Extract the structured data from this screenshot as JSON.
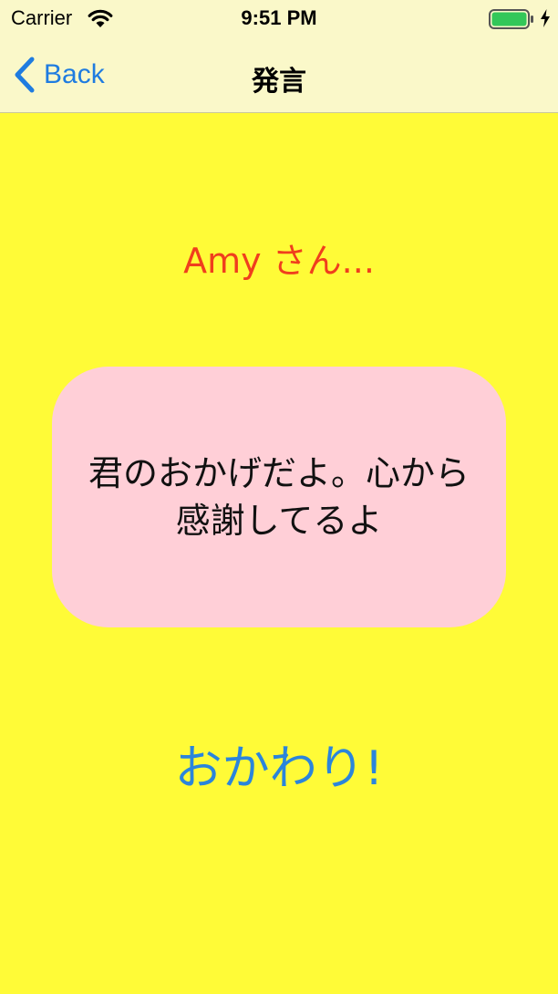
{
  "status_bar": {
    "carrier": "Carrier",
    "time": "9:51 PM"
  },
  "nav": {
    "back_label": "Back",
    "title": "発言"
  },
  "content": {
    "speaker": "Amy さん...",
    "message": "君のおかげだよ。心から\n感謝してるよ",
    "action_label": "おかわり!"
  },
  "colors": {
    "background": "#fffb37",
    "navbar_background": "#faf8c9",
    "speaker_text": "#f03e1d",
    "bubble_background": "#ffcfd7",
    "action_text": "#2b85db",
    "back_text": "#1f7ce0",
    "battery": "#33c759"
  },
  "icons": {
    "wifi": "wifi-icon",
    "battery": "battery-icon",
    "charging": "charging-bolt-icon",
    "back": "chevron-left-icon"
  }
}
